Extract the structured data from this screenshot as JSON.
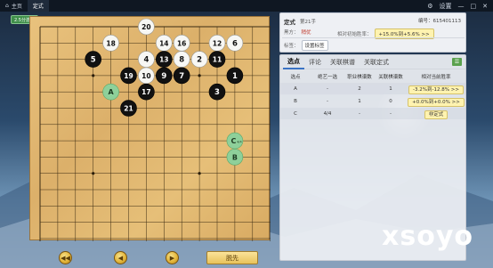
{
  "topbar": {
    "tabs": [
      {
        "label": "主页",
        "active": false
      },
      {
        "label": "定式",
        "active": true
      }
    ],
    "settings_label": "设置",
    "minimize": "—",
    "maximize": "□",
    "close": "✕"
  },
  "badge": {
    "label": "2.5分游戏"
  },
  "board": {
    "size": 19,
    "stones": [
      {
        "color": "white",
        "label": "20",
        "col": 6,
        "row": 0
      },
      {
        "color": "white",
        "label": "18",
        "col": 4,
        "row": 1
      },
      {
        "color": "white",
        "label": "14",
        "col": 7,
        "row": 1
      },
      {
        "color": "white",
        "label": "16",
        "col": 8,
        "row": 1
      },
      {
        "color": "white",
        "label": "12",
        "col": 10,
        "row": 1
      },
      {
        "color": "white",
        "label": "6",
        "col": 11,
        "row": 1
      },
      {
        "color": "black",
        "label": "5",
        "col": 3,
        "row": 2
      },
      {
        "color": "white",
        "label": "4",
        "col": 6,
        "row": 2
      },
      {
        "color": "black",
        "label": "13",
        "col": 7,
        "row": 2
      },
      {
        "color": "white",
        "label": "8",
        "col": 8,
        "row": 2
      },
      {
        "color": "white",
        "label": "2",
        "col": 9,
        "row": 2
      },
      {
        "color": "black",
        "label": "11",
        "col": 10,
        "row": 2
      },
      {
        "color": "black",
        "label": "19",
        "col": 5,
        "row": 3
      },
      {
        "color": "white",
        "label": "10",
        "col": 6,
        "row": 3
      },
      {
        "color": "black",
        "label": "9",
        "col": 7,
        "row": 3
      },
      {
        "color": "black",
        "label": "7",
        "col": 8,
        "row": 3
      },
      {
        "color": "black",
        "label": "1",
        "col": 11,
        "row": 3
      },
      {
        "color": "black",
        "label": "17",
        "col": 6,
        "row": 4
      },
      {
        "color": "black",
        "label": "3",
        "col": 10,
        "row": 4
      },
      {
        "color": "black",
        "label": "21",
        "col": 5,
        "row": 5
      }
    ],
    "markers": [
      {
        "label": "A",
        "col": 4,
        "row": 4,
        "color": "#8ed09a"
      },
      {
        "label": "C",
        "sub": "4/4",
        "col": 11,
        "row": 7,
        "color": "#8ed09a"
      },
      {
        "label": "B",
        "col": 11,
        "row": 8,
        "color": "#8ed09a"
      }
    ]
  },
  "controls": {
    "first": "◀◀",
    "prev": "◀",
    "next": "▶",
    "pass": "脱先"
  },
  "info": {
    "title": "定式",
    "move": "第21手",
    "serial": "编号：615401113",
    "result_label": "黑方：",
    "result_value": "稍优",
    "winrate_label": "相对初始胜率：",
    "winrate_value": "+15.0%到+5.6% >>",
    "tag_label": "标签：",
    "tag_button": "设置标签"
  },
  "panel": {
    "tabs": [
      "选点",
      "评论",
      "关联棋谱",
      "关联定式"
    ],
    "active_tab": "选点",
    "headers": [
      "选点",
      "绝艺一选",
      "职业棋谱数",
      "关联棋谱数",
      "相对当前胜率"
    ],
    "rows": [
      {
        "point": "A",
        "jueyi": "-",
        "pro": "2",
        "assoc": "1",
        "rate": "-3.2%到-12.8% >>"
      },
      {
        "point": "B",
        "jueyi": "-",
        "pro": "1",
        "assoc": "0",
        "rate": "+0.0%到+0.0% >>"
      },
      {
        "point": "C",
        "jueyi": "4/4",
        "pro": "-",
        "assoc": "-",
        "rate": "非定式"
      }
    ]
  },
  "watermark": "xsoyo"
}
